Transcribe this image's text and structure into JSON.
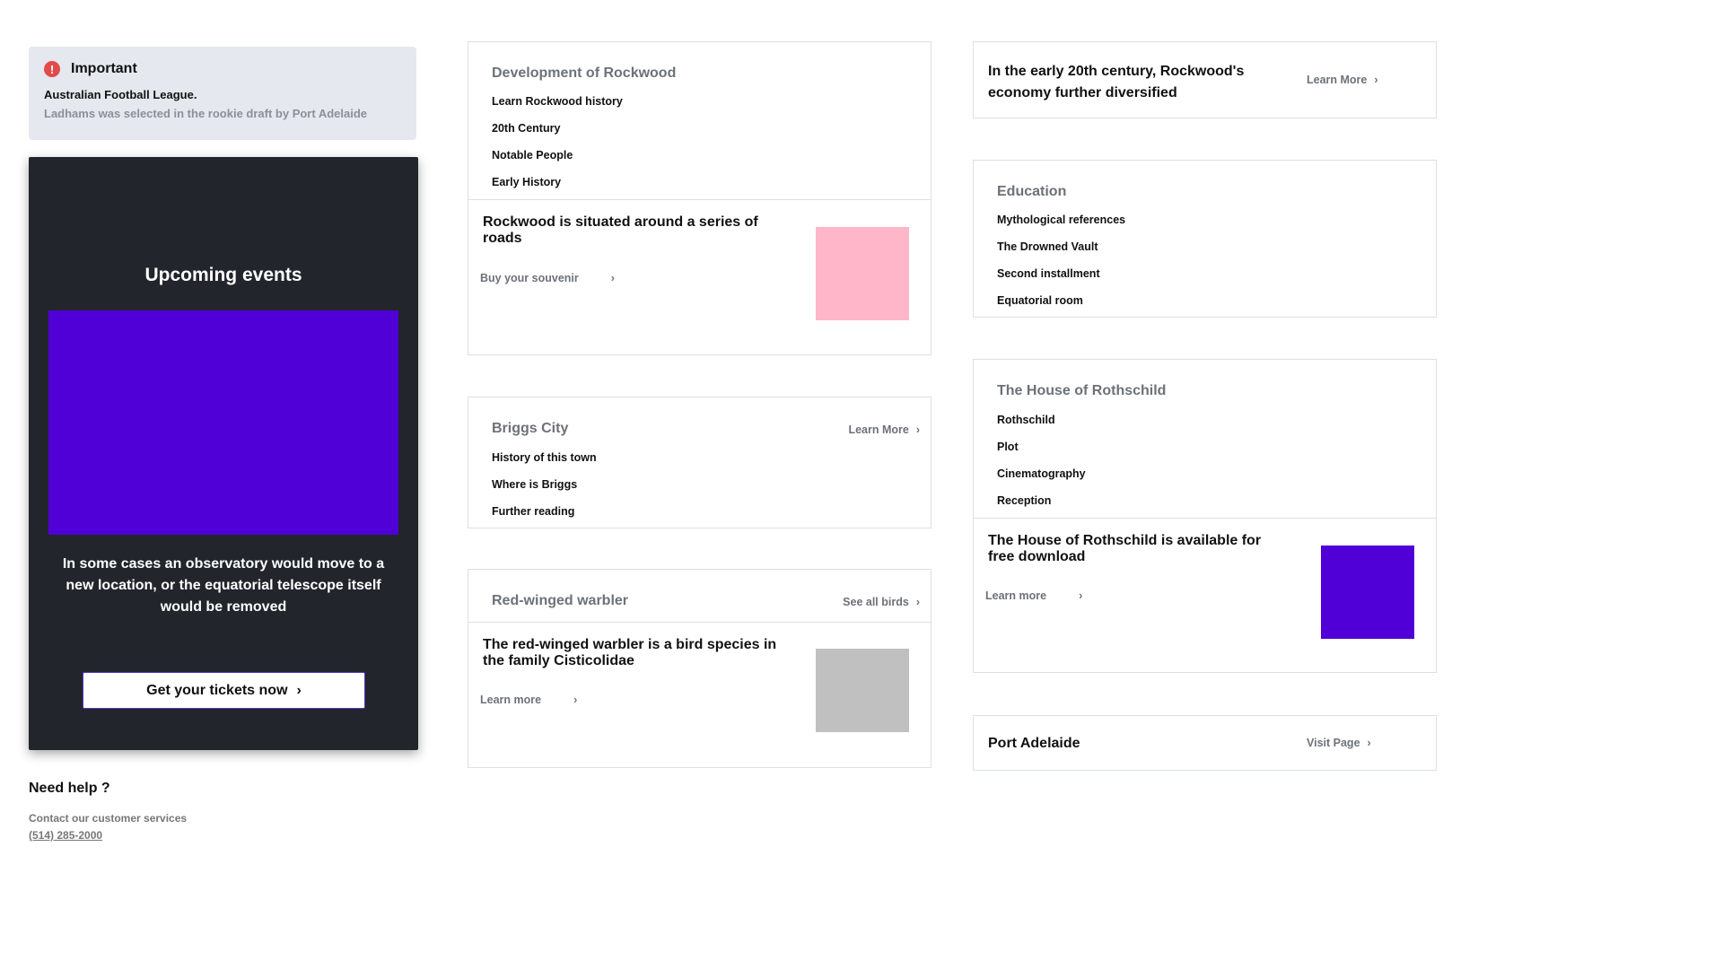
{
  "alert": {
    "title": "Important",
    "line1": "Australian Football League.",
    "line2": "Ladhams was selected in the rookie draft by Port Adelaide"
  },
  "events": {
    "title": "Upcoming events",
    "text": "In some cases an observatory would move to a new location, or the equatorial telescope itself would be removed",
    "button": "Get your tickets now",
    "image_color": "#5000d6"
  },
  "help": {
    "title": "Need help ?",
    "text": "Contact our customer services",
    "phone": "(514) 285-2000"
  },
  "rockwood": {
    "heading": "Development of Rockwood",
    "links": [
      "Learn Rockwood history",
      "20th Century",
      "Notable People",
      "Early History"
    ],
    "promo_title": "Rockwood is situated around a series of roads",
    "promo_link": "Buy your souvenir",
    "thumb_color": "#ffb6c8"
  },
  "briggs": {
    "heading": "Briggs City",
    "head_link": "Learn More",
    "links": [
      "History of this town",
      "Where is Briggs",
      "Further reading"
    ]
  },
  "warbler": {
    "heading": "Red-winged warbler",
    "head_link": "See all birds",
    "promo_title": "The red-winged warbler is a bird species in the family Cisticolidae",
    "promo_link": "Learn more",
    "thumb_color": "#c0c0c0"
  },
  "economy": {
    "title": "In the early 20th century, Rockwood's economy further diversified",
    "link": "Learn More"
  },
  "education": {
    "heading": "Education",
    "links": [
      "Mythological references",
      "The Drowned Vault",
      "Second installment",
      "Equatorial room"
    ]
  },
  "rothschild": {
    "heading": "The House of Rothschild",
    "links": [
      "Rothschild",
      "Plot",
      "Cinematography",
      "Reception"
    ],
    "promo_title": "The House of Rothschild is available for free download",
    "promo_link": "Learn more",
    "thumb_color": "#5000d6"
  },
  "port": {
    "title": "Port Adelaide",
    "link": "Visit Page"
  },
  "icons": {
    "chevron": "›",
    "alert": "!"
  }
}
